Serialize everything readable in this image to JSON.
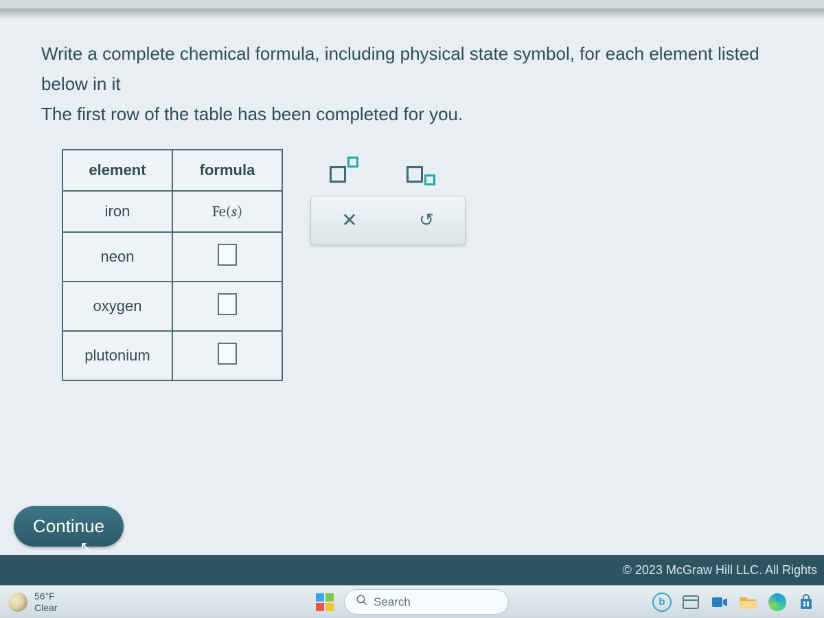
{
  "question": {
    "line1": "Write a complete chemical formula, including physical state symbol, for each element listed below in it",
    "line2": "The first row of the table has been completed for you."
  },
  "table": {
    "headers": {
      "element": "element",
      "formula": "formula"
    },
    "rows": [
      {
        "element": "iron",
        "formula_sym": "Fe",
        "formula_state": "s",
        "filled": true
      },
      {
        "element": "neon",
        "formula_sym": "",
        "formula_state": "",
        "filled": false
      },
      {
        "element": "oxygen",
        "formula_sym": "",
        "formula_state": "",
        "filled": false
      },
      {
        "element": "plutonium",
        "formula_sym": "",
        "formula_state": "",
        "filled": false
      }
    ]
  },
  "tools": {
    "superscript": "superscript",
    "subscript": "subscript",
    "clear": "×",
    "reset": "↺"
  },
  "continue_label": "Continue",
  "copyright": "© 2023 McGraw Hill LLC. All Rights",
  "taskbar": {
    "weather_temp": "56°F",
    "weather_cond": "Clear",
    "search_placeholder": "Search"
  }
}
